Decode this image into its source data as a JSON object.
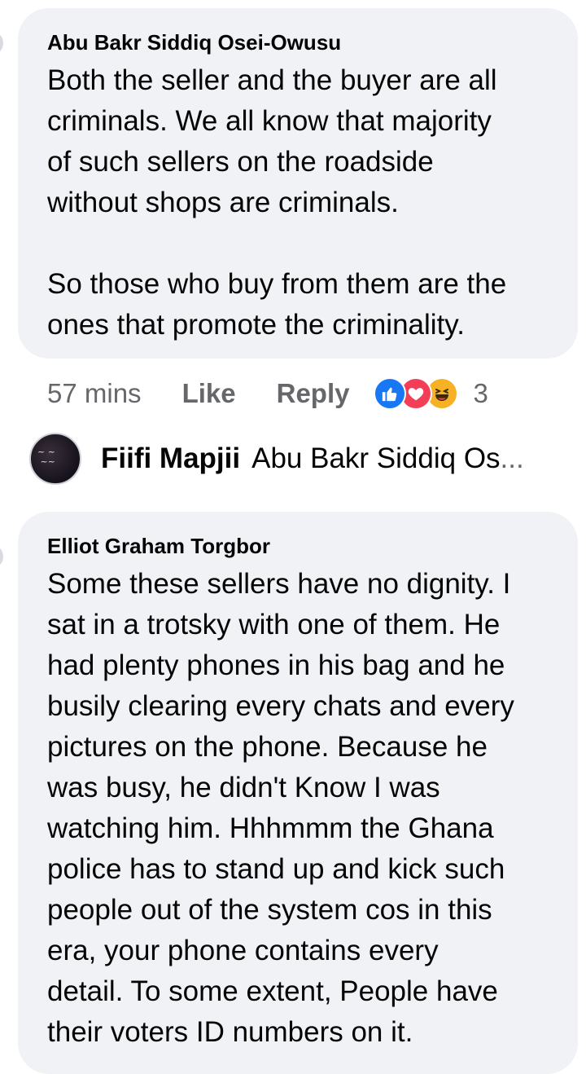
{
  "comments": [
    {
      "author": "Abu Bakr Siddiq Osei-Owusu",
      "paragraphs": [
        "Both the seller and the buyer are all\ncriminals. We all know that majority\nof such sellers on the roadside\nwithout shops are criminals.",
        "So those who buy from them are the\nones that promote the criminality."
      ],
      "time": "57 mins",
      "like_label": "Like",
      "reply_label": "Reply",
      "reactions": [
        "like-icon",
        "love-icon",
        "haha-icon"
      ],
      "reaction_count": "3"
    },
    {
      "author": "Elliot Graham Torgbor",
      "paragraphs": [
        "Some these sellers have no dignity. I\nsat in a trotsky with one of them. He\nhad plenty phones in his bag and he\nbusily clearing every chats and every\npictures on the phone. Because he\nwas busy, he didn't Know I was\nwatching him. Hhhmmm the Ghana\npolice has to stand up and kick such\npeople out of the system cos in this\nera, your phone contains every\ndetail. To some extent, People have\ntheir voters ID numbers on it."
      ]
    }
  ],
  "reply_preview": {
    "author": "Fiifi Mapjii",
    "text": "Abu Bakr Siddiq Os",
    "ellipsis": "..."
  },
  "colors": {
    "bubble": "#f0f2f5",
    "secondary_text": "#65676b",
    "like": "#1877f2",
    "love": "#f33e58",
    "haha": "#f7b125"
  }
}
